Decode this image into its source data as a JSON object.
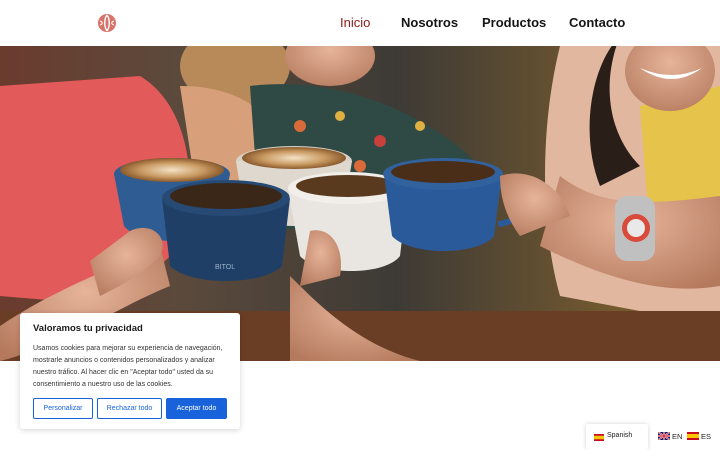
{
  "nav": {
    "items": [
      {
        "label": "Inicio"
      },
      {
        "label": "Nosotros"
      },
      {
        "label": "Productos"
      },
      {
        "label": "Contacto"
      }
    ]
  },
  "brand": {
    "logo_icon": "coffee-bean-logo",
    "accent_color": "#8b1a1a"
  },
  "cookie_banner": {
    "title": "Valoramos tu privacidad",
    "text": "Usamos cookies para mejorar su experiencia de navegación, mostrarle anuncios o contenidos personalizados y analizar nuestro tráfico. Al hacer clic en \"Aceptar todo\" usted da su consentimiento a nuestro uso de las cookies.",
    "buttons": {
      "customize": "Personalizar",
      "reject": "Rechazar todo",
      "accept": "Aceptar todo"
    },
    "button_color": "#1863dc"
  },
  "language": {
    "dropdown_label": "Spanish",
    "options": [
      {
        "code": "EN",
        "flag": "uk-flag-icon"
      },
      {
        "code": "ES",
        "flag": "spain-flag-icon"
      }
    ]
  }
}
